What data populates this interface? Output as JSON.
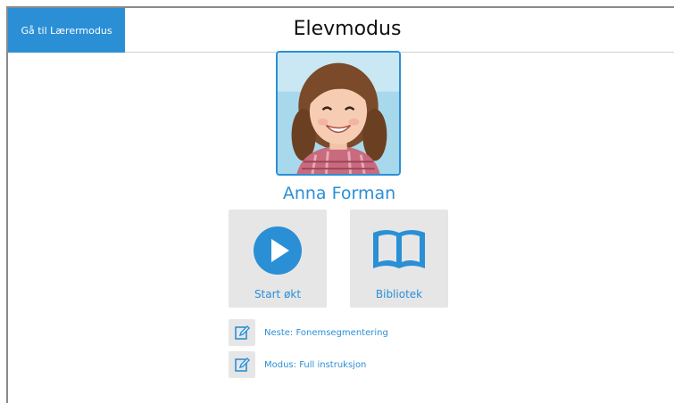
{
  "header": {
    "teacher_mode_label": "Gå til Lærermodus",
    "title": "Elevmodus"
  },
  "student": {
    "name": "Anna Forman",
    "photo_icon": "student-photo"
  },
  "tiles": {
    "start_label": "Start økt",
    "start_icon": "play-icon",
    "library_label": "Bibliotek",
    "library_icon": "book-icon"
  },
  "info": {
    "next_label": "Neste: Fonemsegmentering",
    "mode_label": "Modus: Full instruksjon",
    "edit_icon": "edit-icon"
  },
  "colors": {
    "accent": "#2b8fd6",
    "tile_bg": "#e6e6e6",
    "title_text": "#111111"
  }
}
